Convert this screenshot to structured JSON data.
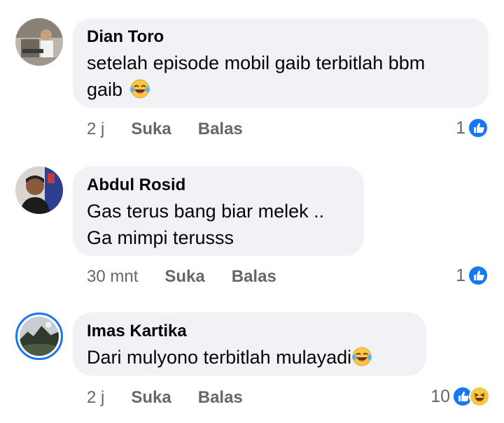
{
  "comments": [
    {
      "author": "Dian Toro",
      "text_line1": "setelah episode mobil gaib terbitlah bbm",
      "text_line2": "gaib",
      "emoji": "laughing-tears-emoji",
      "time": "2 j",
      "like_label": "Suka",
      "reply_label": "Balas",
      "reaction_count": "1",
      "reactions": [
        "like-icon"
      ]
    },
    {
      "author": "Abdul Rosid",
      "text_line1": "Gas terus bang biar melek ..",
      "text_line2": "Ga mimpi terusss",
      "time": "30 mnt",
      "like_label": "Suka",
      "reply_label": "Balas",
      "reaction_count": "1",
      "reactions": [
        "like-icon"
      ]
    },
    {
      "author": "Imas Kartika",
      "text_line1": "Dari mulyono terbitlah mulayadi",
      "emoji": "laughing-tears-emoji",
      "time": "2 j",
      "like_label": "Suka",
      "reply_label": "Balas",
      "reaction_count": "10",
      "reactions": [
        "like-icon",
        "laughing-emoji"
      ]
    }
  ],
  "colors": {
    "bubble": "#f0f2f5",
    "like_blue": "#1877f2",
    "meta_gray": "#65676b",
    "avatar_ring": "#1877f2"
  }
}
